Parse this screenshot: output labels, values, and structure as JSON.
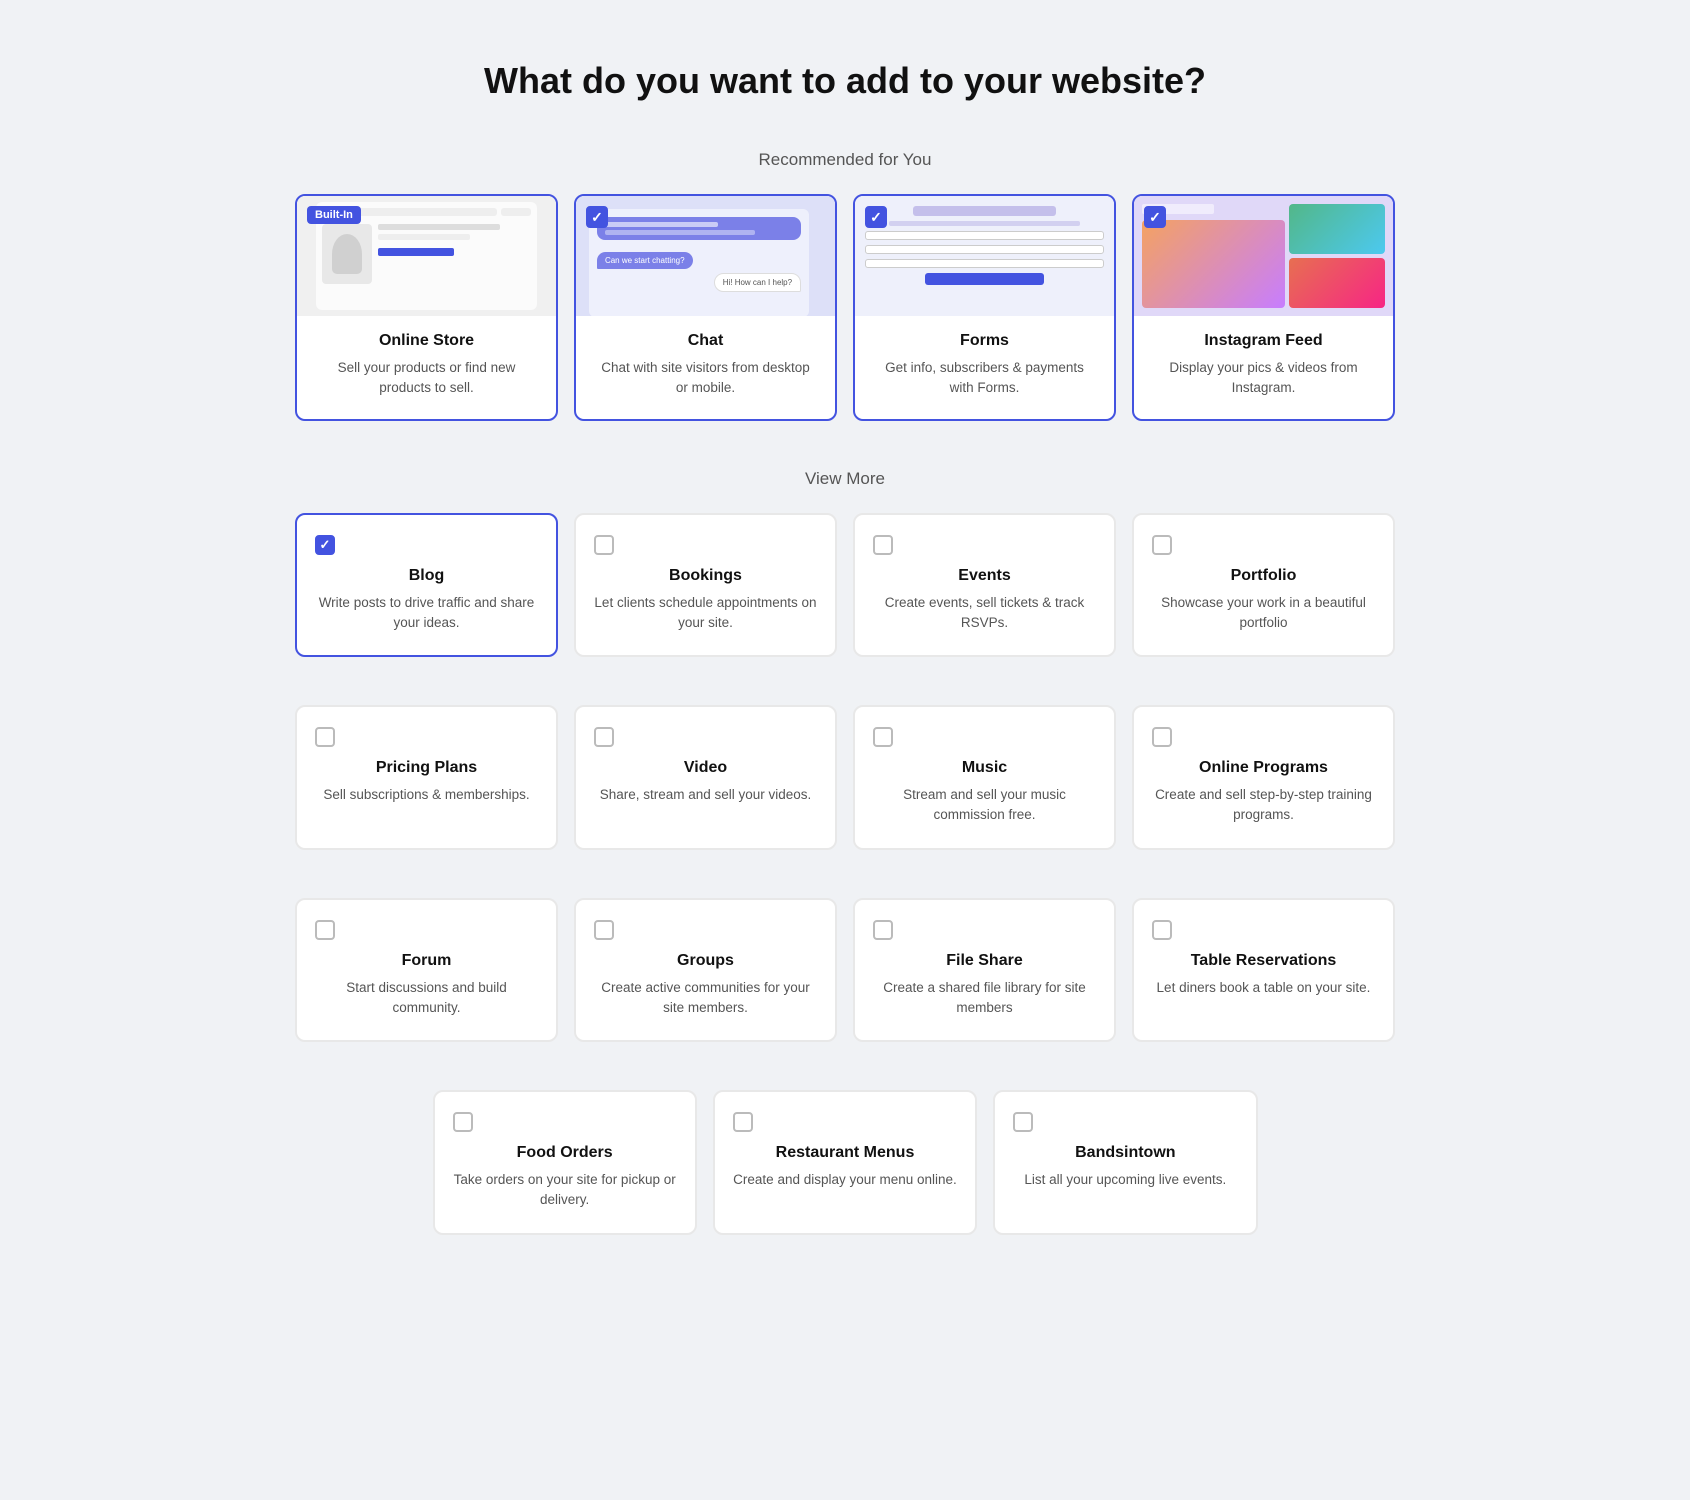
{
  "page": {
    "title": "What do you want to add to your website?"
  },
  "recommended": {
    "label": "Recommended for You",
    "items": [
      {
        "id": "online-store",
        "title": "Online Store",
        "desc": "Sell your products or find new products to sell.",
        "badge": "Built-In",
        "selected": false,
        "checkType": "badge"
      },
      {
        "id": "chat",
        "title": "Chat",
        "desc": "Chat with site visitors from desktop or mobile.",
        "badge": null,
        "selected": true,
        "checkType": "check"
      },
      {
        "id": "forms",
        "title": "Forms",
        "desc": "Get info, subscribers & payments with Forms.",
        "badge": null,
        "selected": true,
        "checkType": "check"
      },
      {
        "id": "instagram-feed",
        "title": "Instagram Feed",
        "desc": "Display your pics & videos from Instagram.",
        "badge": null,
        "selected": true,
        "checkType": "check"
      }
    ]
  },
  "viewmore": {
    "label": "View More",
    "rows": [
      [
        {
          "id": "blog",
          "title": "Blog",
          "desc": "Write posts to drive traffic and share your ideas.",
          "selected": true
        },
        {
          "id": "bookings",
          "title": "Bookings",
          "desc": "Let clients schedule appointments on your site.",
          "selected": false
        },
        {
          "id": "events",
          "title": "Events",
          "desc": "Create events, sell tickets & track RSVPs.",
          "selected": false
        },
        {
          "id": "portfolio",
          "title": "Portfolio",
          "desc": "Showcase your work in a beautiful portfolio",
          "selected": false
        }
      ],
      [
        {
          "id": "pricing-plans",
          "title": "Pricing Plans",
          "desc": "Sell subscriptions & memberships.",
          "selected": false
        },
        {
          "id": "video",
          "title": "Video",
          "desc": "Share, stream and sell your videos.",
          "selected": false
        },
        {
          "id": "music",
          "title": "Music",
          "desc": "Stream and sell your music commission free.",
          "selected": false
        },
        {
          "id": "online-programs",
          "title": "Online Programs",
          "desc": "Create and sell step-by-step training programs.",
          "selected": false
        }
      ],
      [
        {
          "id": "forum",
          "title": "Forum",
          "desc": "Start discussions and build community.",
          "selected": false
        },
        {
          "id": "groups",
          "title": "Groups",
          "desc": "Create active communities for your site members.",
          "selected": false
        },
        {
          "id": "file-share",
          "title": "File Share",
          "desc": "Create a shared file library for site members",
          "selected": false
        },
        {
          "id": "table-reservations",
          "title": "Table Reservations",
          "desc": "Let diners book a table on your site.",
          "selected": false
        }
      ]
    ],
    "bottom_row": [
      {
        "id": "food-orders",
        "title": "Food Orders",
        "desc": "Take orders on your site for pickup or delivery.",
        "selected": false
      },
      {
        "id": "restaurant-menus",
        "title": "Restaurant Menus",
        "desc": "Create and display your menu online.",
        "selected": false
      },
      {
        "id": "bandsintown",
        "title": "Bandsintown",
        "desc": "List all your upcoming live events.",
        "selected": false
      }
    ]
  },
  "icons": {
    "check": "✓",
    "unchecked": ""
  }
}
